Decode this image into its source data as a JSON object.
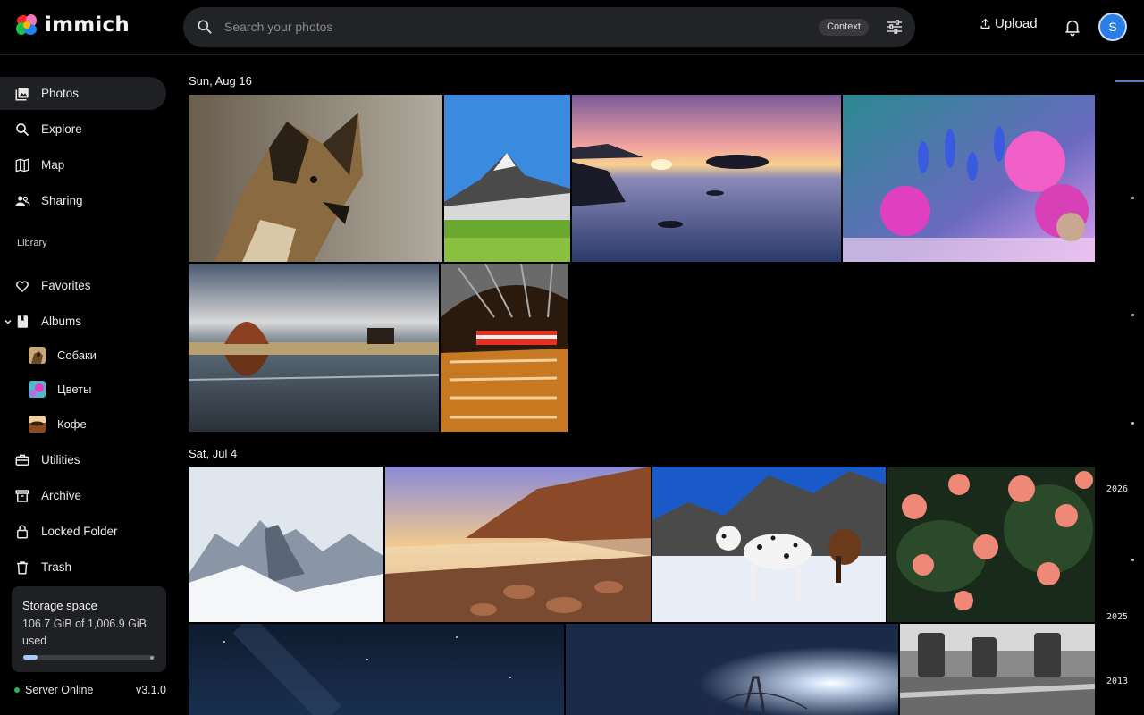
{
  "app": {
    "name": "immich"
  },
  "search": {
    "placeholder": "Search your photos",
    "context_label": "Context"
  },
  "header": {
    "upload_label": "Upload",
    "avatar_initial": "S"
  },
  "sidebar": {
    "items": [
      {
        "label": "Photos",
        "icon": "photos-icon",
        "active": true
      },
      {
        "label": "Explore",
        "icon": "search-icon"
      },
      {
        "label": "Map",
        "icon": "map-icon"
      },
      {
        "label": "Sharing",
        "icon": "people-icon"
      }
    ],
    "library_label": "Library",
    "library_items": [
      {
        "label": "Favorites",
        "icon": "heart-icon"
      },
      {
        "label": "Albums",
        "icon": "album-icon"
      }
    ],
    "albums": [
      {
        "label": "Собаки",
        "color": "#b08a55"
      },
      {
        "label": "Цветы",
        "color": "#c250c8"
      },
      {
        "label": "Кофе",
        "color": "#8a4a22"
      }
    ],
    "utility_items": [
      {
        "label": "Utilities",
        "icon": "toolbox-icon"
      },
      {
        "label": "Archive",
        "icon": "archive-icon"
      },
      {
        "label": "Locked Folder",
        "icon": "lock-icon"
      },
      {
        "label": "Trash",
        "icon": "trash-icon"
      }
    ],
    "storage": {
      "title": "Storage space",
      "used_text": "106.7 GiB of 1,006.9 GiB used",
      "used_fraction": 0.106
    },
    "server": {
      "status": "Server Online",
      "version": "v3.1.0"
    }
  },
  "timeline": {
    "groups": [
      {
        "date": "Sun, Aug 16",
        "photos": [
          "african-wild-dog",
          "mountain-meadow",
          "sunset-beach",
          "pink-blue-flowers",
          "lake-tree-reflection",
          "train-station"
        ]
      },
      {
        "date": "Sat, Jul 4",
        "photos": [
          "snowy-peaks",
          "rocky-shore-sunset",
          "dogs-in-snow",
          "pink-roses",
          "night-sky",
          "bridge-sun",
          "cafe-chairs"
        ]
      }
    ],
    "years": [
      "2026",
      "2025",
      "2013"
    ]
  },
  "colors": {
    "accent": "#2a7fe6",
    "online": "#2fb153",
    "storage_fill": "#a9c8ff"
  }
}
